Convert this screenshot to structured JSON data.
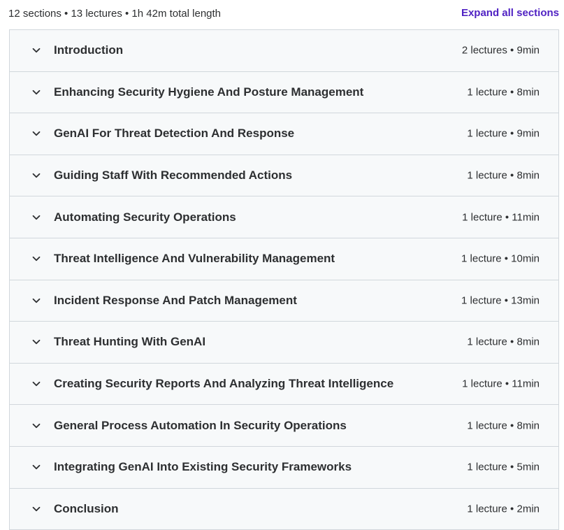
{
  "summary": "12 sections • 13 lectures • 1h 42m total length",
  "expand_all_label": "Expand all sections",
  "icons": {
    "section_toggle": "chevron-down-icon"
  },
  "colors": {
    "accent": "#5022c3",
    "section_bg": "#f7f9fa",
    "border": "#d1d7dc",
    "text": "#2d2f31"
  },
  "sections": [
    {
      "title": "Introduction",
      "meta": "2 lectures • 9min"
    },
    {
      "title": "Enhancing Security Hygiene And Posture Management",
      "meta": "1 lecture • 8min"
    },
    {
      "title": "GenAI For Threat Detection And Response",
      "meta": "1 lecture • 9min"
    },
    {
      "title": "Guiding Staff With Recommended Actions",
      "meta": "1 lecture • 8min"
    },
    {
      "title": "Automating Security Operations",
      "meta": "1 lecture • 11min"
    },
    {
      "title": "Threat Intelligence And Vulnerability Management",
      "meta": "1 lecture • 10min"
    },
    {
      "title": "Incident Response And Patch Management",
      "meta": "1 lecture • 13min"
    },
    {
      "title": "Threat Hunting With GenAI",
      "meta": "1 lecture • 8min"
    },
    {
      "title": "Creating Security Reports And Analyzing Threat Intelligence",
      "meta": "1 lecture • 11min"
    },
    {
      "title": "General Process Automation In Security Operations",
      "meta": "1 lecture • 8min"
    },
    {
      "title": "Integrating GenAI Into Existing Security Frameworks",
      "meta": "1 lecture • 5min"
    },
    {
      "title": "Conclusion",
      "meta": "1 lecture • 2min"
    }
  ]
}
